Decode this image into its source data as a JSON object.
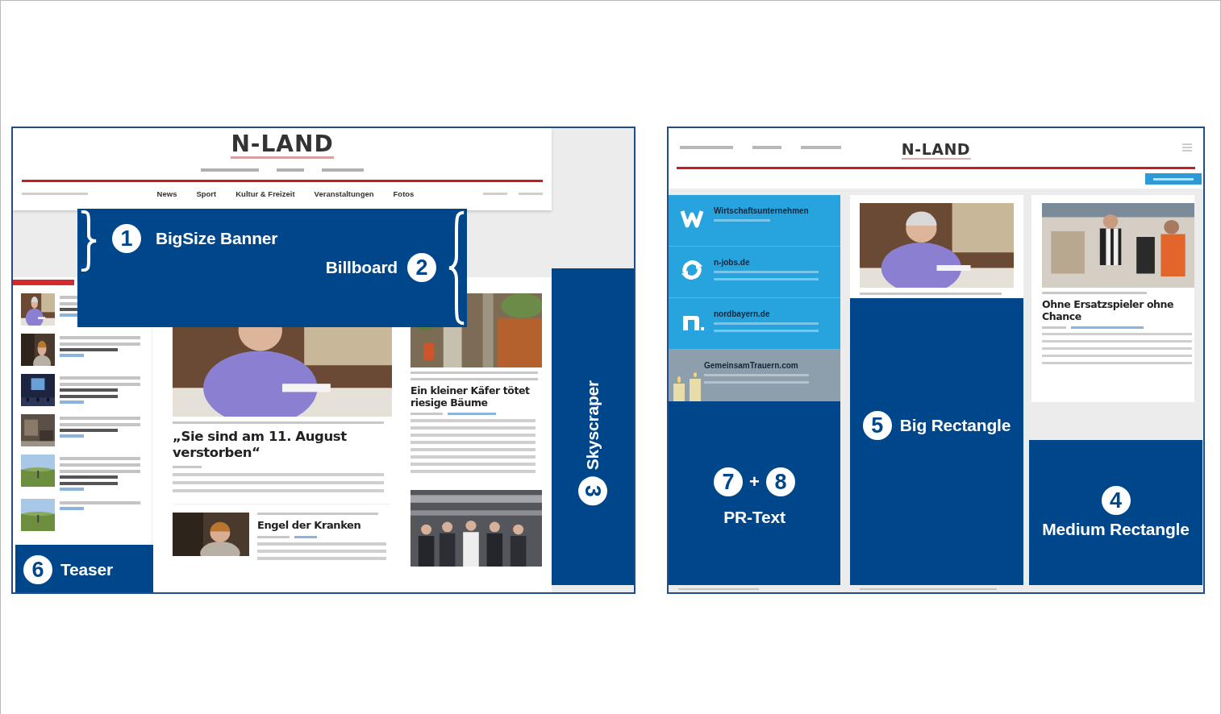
{
  "desktop": {
    "logo": "N-LAND",
    "nav": [
      "News",
      "Sport",
      "Kultur & Freizeit",
      "Veranstaltungen",
      "Fotos"
    ],
    "main_article": {
      "headline": "„Sie sind am 11. August verstorben“"
    },
    "small_article": {
      "headline": "Engel der Kranken"
    },
    "side_article": {
      "headline": "Ein kleiner Käfer tötet riesige Bäume"
    },
    "banner_overlay": {
      "left": {
        "number": "1",
        "label": "BigSize Banner"
      },
      "right": {
        "number": "2",
        "label": "Billboard"
      }
    },
    "skyscraper_overlay": {
      "number": "3",
      "label": "Skyscraper"
    },
    "teaser_overlay": {
      "number": "6",
      "label": "Teaser"
    }
  },
  "tablet": {
    "logo": "N-LAND",
    "partners": [
      {
        "name": "Wirtschaftsunternehmen"
      },
      {
        "name": "n-jobs.de"
      },
      {
        "name": "nordbayern.de"
      },
      {
        "name": "GemeinsamTrauern.com"
      }
    ],
    "article": {
      "headline": "Ohne Ersatzspieler ohne Chance"
    },
    "pr_overlay": {
      "numbers": [
        "7",
        "8"
      ],
      "joiner": "+",
      "label": "PR-Text"
    },
    "big_rectangle_overlay": {
      "number": "5",
      "label": "Big Rectangle"
    },
    "medium_rectangle_overlay": {
      "number": "4",
      "label": "Medium Rectangle"
    }
  }
}
